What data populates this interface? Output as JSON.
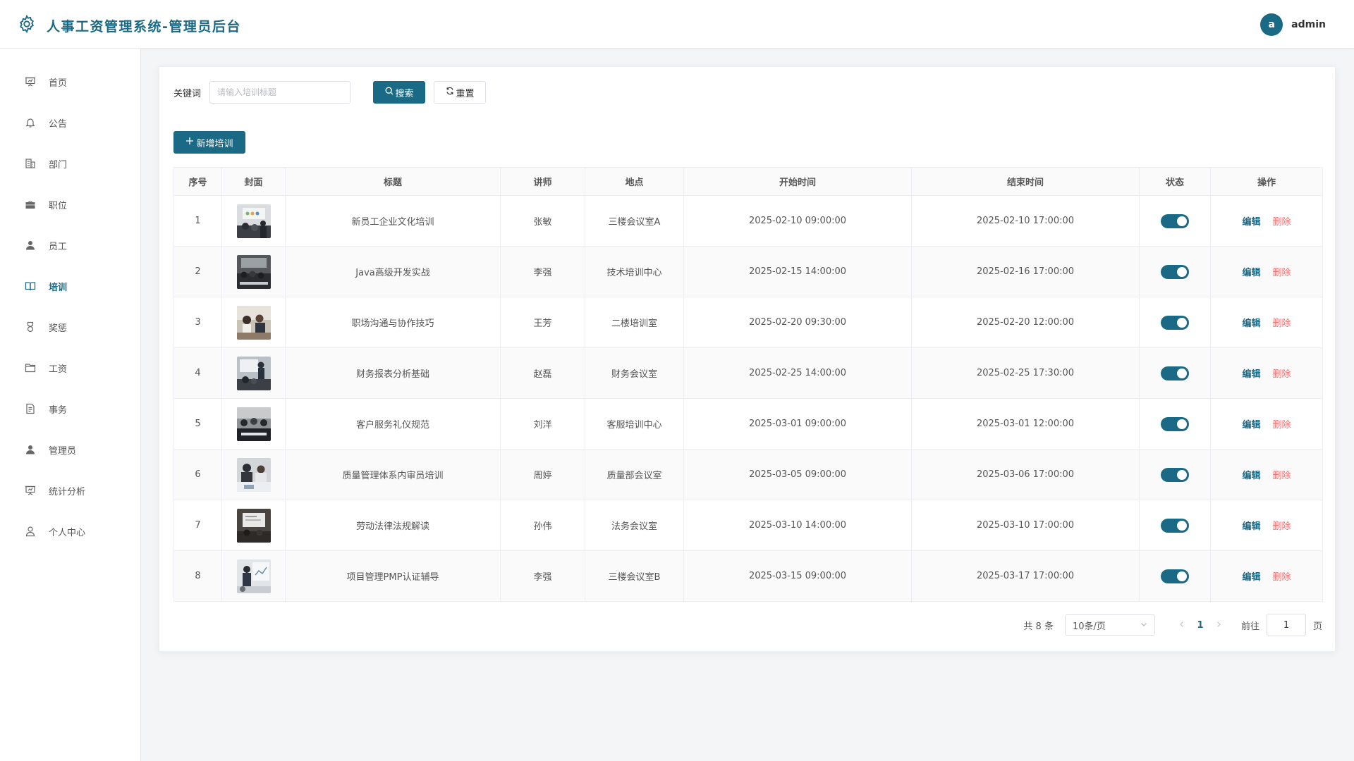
{
  "header": {
    "title": "人事工资管理系统-管理员后台",
    "logo_icon": "gear-icon",
    "avatar_letter": "a",
    "username": "admin",
    "accent": "#1a6a85"
  },
  "sidebar": {
    "items": [
      {
        "label": "首页",
        "icon": "presentation-icon",
        "active": false
      },
      {
        "label": "公告",
        "icon": "bell-icon",
        "active": false
      },
      {
        "label": "部门",
        "icon": "office-building-icon",
        "active": false
      },
      {
        "label": "职位",
        "icon": "briefcase-icon",
        "active": false
      },
      {
        "label": "员工",
        "icon": "user-filled-icon",
        "active": false
      },
      {
        "label": "培训",
        "icon": "book-icon",
        "active": true
      },
      {
        "label": "奖惩",
        "icon": "medal-icon",
        "active": false
      },
      {
        "label": "工资",
        "icon": "folder-icon",
        "active": false
      },
      {
        "label": "事务",
        "icon": "document-icon",
        "active": false
      },
      {
        "label": "管理员",
        "icon": "user-filled-icon",
        "active": false
      },
      {
        "label": "统计分析",
        "icon": "chart-board-icon",
        "active": false
      },
      {
        "label": "个人中心",
        "icon": "user-outline-icon",
        "active": false
      }
    ]
  },
  "filter": {
    "keyword_label": "关键词",
    "keyword_placeholder": "请输入培训标题",
    "keyword_value": "",
    "search_label": "搜索",
    "reset_label": "重置"
  },
  "toolbar": {
    "add_label": "新增培训"
  },
  "table": {
    "columns": [
      "序号",
      "封面",
      "标题",
      "讲师",
      "地点",
      "开始时间",
      "结束时间",
      "状态",
      "操作"
    ],
    "edit_label": "编辑",
    "delete_label": "删除",
    "rows": [
      {
        "index": "1",
        "title": "新员工企业文化培训",
        "lecturer": "张敏",
        "location": "三楼会议室A",
        "start": "2025-02-10 09:00:00",
        "end": "2025-02-10 17:00:00",
        "enabled": true
      },
      {
        "index": "2",
        "title": "Java高级开发实战",
        "lecturer": "李强",
        "location": "技术培训中心",
        "start": "2025-02-15 14:00:00",
        "end": "2025-02-16 17:00:00",
        "enabled": true
      },
      {
        "index": "3",
        "title": "职场沟通与协作技巧",
        "lecturer": "王芳",
        "location": "二楼培训室",
        "start": "2025-02-20 09:30:00",
        "end": "2025-02-20 12:00:00",
        "enabled": true
      },
      {
        "index": "4",
        "title": "财务报表分析基础",
        "lecturer": "赵磊",
        "location": "财务会议室",
        "start": "2025-02-25 14:00:00",
        "end": "2025-02-25 17:30:00",
        "enabled": true
      },
      {
        "index": "5",
        "title": "客户服务礼仪规范",
        "lecturer": "刘洋",
        "location": "客服培训中心",
        "start": "2025-03-01 09:00:00",
        "end": "2025-03-01 12:00:00",
        "enabled": true
      },
      {
        "index": "6",
        "title": "质量管理体系内审员培训",
        "lecturer": "周婷",
        "location": "质量部会议室",
        "start": "2025-03-05 09:00:00",
        "end": "2025-03-06 17:00:00",
        "enabled": true
      },
      {
        "index": "7",
        "title": "劳动法律法规解读",
        "lecturer": "孙伟",
        "location": "法务会议室",
        "start": "2025-03-10 14:00:00",
        "end": "2025-03-10 17:00:00",
        "enabled": true
      },
      {
        "index": "8",
        "title": "项目管理PMP认证辅导",
        "lecturer": "李强",
        "location": "三楼会议室B",
        "start": "2025-03-15 09:00:00",
        "end": "2025-03-17 17:00:00",
        "enabled": true
      }
    ]
  },
  "pagination": {
    "total_text": "共 8 条",
    "page_size": "10条/页",
    "current_page": "1",
    "goto_label": "前往",
    "goto_value": "1",
    "page_suffix": "页"
  }
}
